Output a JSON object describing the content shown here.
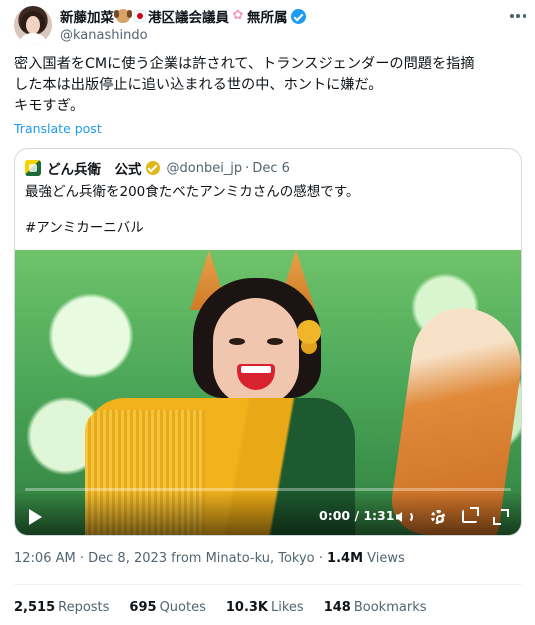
{
  "author": {
    "display_name": "新藤加菜",
    "affiliation": "港区議会議員",
    "party": "無所属",
    "handle": "@kanashindo",
    "badges": [
      "dog-emoji",
      "japan-flag-emoji",
      "cherry-blossom-emoji",
      "verified-badge"
    ]
  },
  "tweet": {
    "lines": [
      "密入国者をCMに使う企業は許されて、トランスジェンダーの問題を指摘",
      "した本は出版停止に追い込まれる世の中、ホントに嫌だ。",
      "キモすぎ。"
    ],
    "translate_label": "Translate post"
  },
  "quoted": {
    "name": "どん兵衛　公式",
    "handle": "@donbei_jp",
    "separator": "·",
    "date": "Dec 6",
    "text": "最強どん兵衛を200食たべたアンミカさんの感想です。",
    "hashtag": "#アンミカーニバル",
    "video": {
      "time": "0:00 / 1:31",
      "progress": 0
    }
  },
  "meta": {
    "time": "12:06 AM",
    "dot1": "·",
    "date": "Dec 8, 2023 from Minato-ku, Tokyo",
    "dot2": "·",
    "views_count": "1.4M",
    "views_label": "Views"
  },
  "stats": [
    {
      "count": "2,515",
      "label": "Reposts"
    },
    {
      "count": "695",
      "label": "Quotes"
    },
    {
      "count": "10.3K",
      "label": "Likes"
    },
    {
      "count": "148",
      "label": "Bookmarks"
    }
  ],
  "colors": {
    "accent": "#1d9bf0",
    "muted": "#536471",
    "gold_badge": "#e2b719"
  }
}
